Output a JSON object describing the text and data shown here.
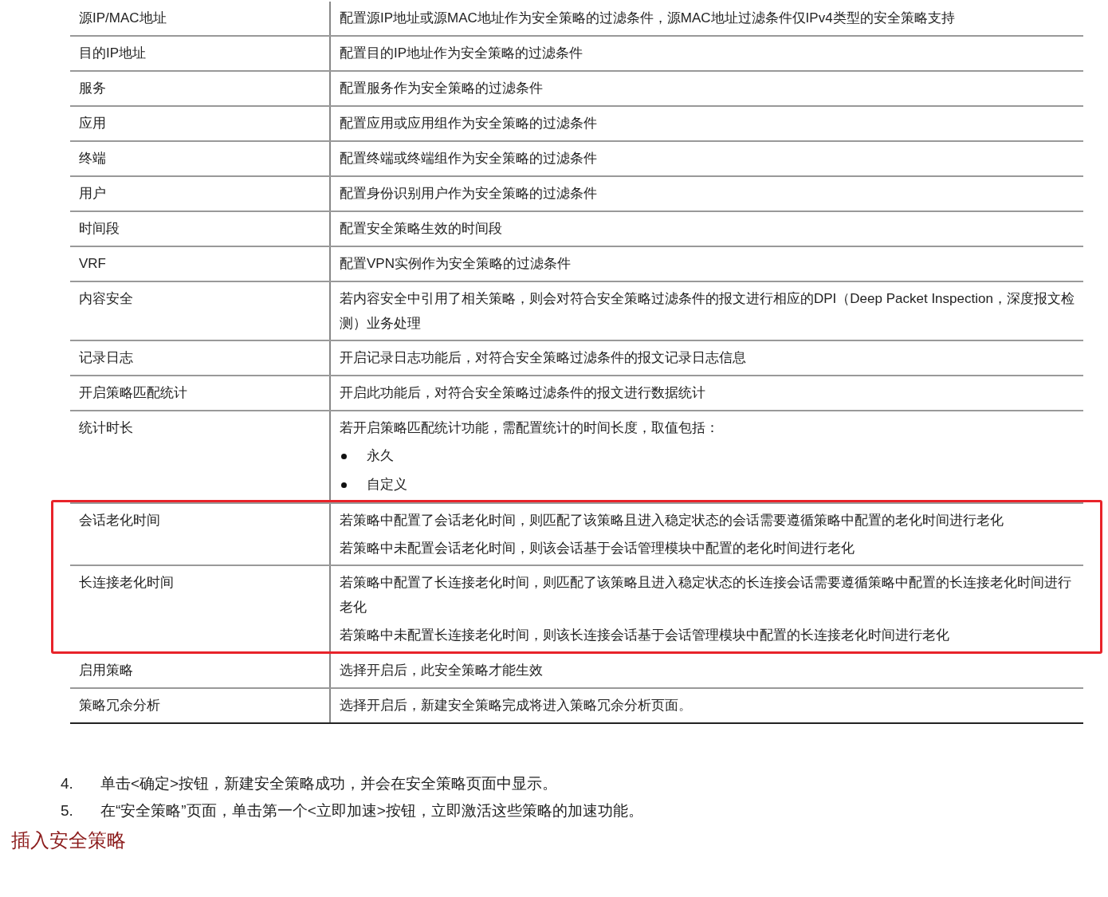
{
  "table": {
    "rows": [
      {
        "name": "源IP/MAC地址",
        "highlighted": false,
        "paragraphs": [
          "配置源IP地址或源MAC地址作为安全策略的过滤条件，源MAC地址过滤条件仅IPv4类型的安全策略支持"
        ]
      },
      {
        "name": "目的IP地址",
        "highlighted": false,
        "paragraphs": [
          "配置目的IP地址作为安全策略的过滤条件"
        ]
      },
      {
        "name": "服务",
        "highlighted": false,
        "paragraphs": [
          "配置服务作为安全策略的过滤条件"
        ]
      },
      {
        "name": "应用",
        "highlighted": false,
        "paragraphs": [
          "配置应用或应用组作为安全策略的过滤条件"
        ]
      },
      {
        "name": "终端",
        "highlighted": false,
        "paragraphs": [
          "配置终端或终端组作为安全策略的过滤条件"
        ]
      },
      {
        "name": "用户",
        "highlighted": false,
        "paragraphs": [
          "配置身份识别用户作为安全策略的过滤条件"
        ]
      },
      {
        "name": "时间段",
        "highlighted": false,
        "paragraphs": [
          "配置安全策略生效的时间段"
        ]
      },
      {
        "name": "VRF",
        "highlighted": false,
        "paragraphs": [
          "配置VPN实例作为安全策略的过滤条件"
        ]
      },
      {
        "name": "内容安全",
        "highlighted": false,
        "paragraphs": [
          "若内容安全中引用了相关策略，则会对符合安全策略过滤条件的报文进行相应的DPI（Deep Packet Inspection，深度报文检测）业务处理"
        ]
      },
      {
        "name": "记录日志",
        "highlighted": false,
        "paragraphs": [
          "开启记录日志功能后，对符合安全策略过滤条件的报文记录日志信息"
        ]
      },
      {
        "name": "开启策略匹配统计",
        "highlighted": false,
        "paragraphs": [
          "开启此功能后，对符合安全策略过滤条件的报文进行数据统计"
        ]
      },
      {
        "name": "统计时长",
        "highlighted": false,
        "paragraphs": [
          "若开启策略匹配统计功能，需配置统计的时间长度，取值包括："
        ],
        "bullets": [
          "永久",
          "自定义"
        ]
      },
      {
        "name": "会话老化时间",
        "highlighted": true,
        "paragraphs": [
          "若策略中配置了会话老化时间，则匹配了该策略且进入稳定状态的会话需要遵循策略中配置的老化时间进行老化",
          "若策略中未配置会话老化时间，则该会话基于会话管理模块中配置的老化时间进行老化"
        ]
      },
      {
        "name": "长连接老化时间",
        "highlighted": true,
        "paragraphs": [
          "若策略中配置了长连接老化时间，则匹配了该策略且进入稳定状态的长连接会话需要遵循策略中配置的长连接老化时间进行老化",
          "若策略中未配置长连接老化时间，则该长连接会话基于会话管理模块中配置的长连接老化时间进行老化"
        ]
      },
      {
        "name": "启用策略",
        "highlighted": false,
        "paragraphs": [
          "选择开启后，此安全策略才能生效"
        ]
      },
      {
        "name": "策略冗余分析",
        "highlighted": false,
        "paragraphs": [
          "选择开启后，新建安全策略完成将进入策略冗余分析页面。"
        ]
      }
    ]
  },
  "steps": [
    {
      "number": "4.",
      "text": "单击<确定>按钮，新建安全策略成功，并会在安全策略页面中显示。"
    },
    {
      "number": "5.",
      "text": "在“安全策略”页面，单击第一个<立即加速>按钮，立即激活这些策略的加速功能。"
    }
  ],
  "heading": "插入安全策略"
}
